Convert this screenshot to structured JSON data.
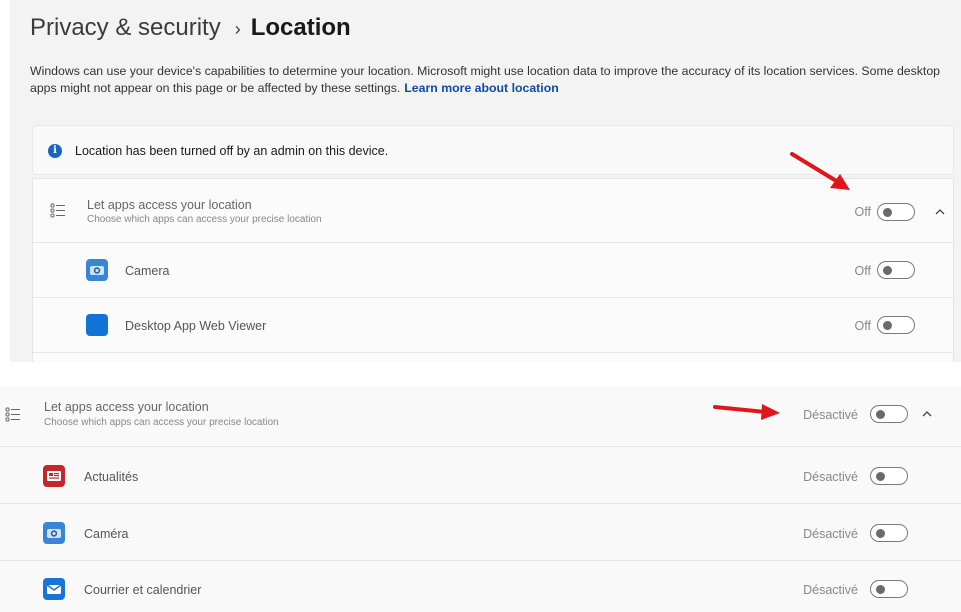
{
  "top": {
    "breadcrumb_parent": "Privacy & security",
    "breadcrumb_sep": "›",
    "breadcrumb_current": "Location",
    "description": "Windows can use your device's capabilities to determine your location. Microsoft might use location data to improve the accuracy of its location services. Some desktop apps might not appear on this page or be affected by these settings.",
    "learn_more": "Learn more about location",
    "info_icon_glyph": "i",
    "info_message": "Location has been turned off by an admin on this device.",
    "main_setting": {
      "title": "Let apps access your location",
      "subtitle": "Choose which apps can access your precise location",
      "state": "Off"
    },
    "apps": [
      {
        "name": "Camera",
        "state": "Off",
        "icon": "camera-icon"
      },
      {
        "name": "Desktop App Web Viewer",
        "state": "Off",
        "icon": "desktop-app-icon"
      }
    ]
  },
  "bottom": {
    "main_setting": {
      "title": "Let apps access your location",
      "subtitle": "Choose which apps can access your precise location",
      "state": "Désactivé"
    },
    "apps": [
      {
        "name": "Actualités",
        "state": "Désactivé",
        "icon": "news-icon"
      },
      {
        "name": "Caméra",
        "state": "Désactivé",
        "icon": "camera-icon"
      },
      {
        "name": "Courrier et calendrier",
        "state": "Désactivé",
        "icon": "mail-icon"
      }
    ]
  },
  "colors": {
    "link": "#0f4aa3",
    "info_icon": "#1a64c8",
    "annotation_arrow": "#e0161b",
    "camera_icon_bg": "#3a86d6",
    "desktop_app_icon_bg": "#1173d4",
    "news_icon_bg": "#c1272d",
    "mail_icon_bg": "#1a73d9"
  }
}
